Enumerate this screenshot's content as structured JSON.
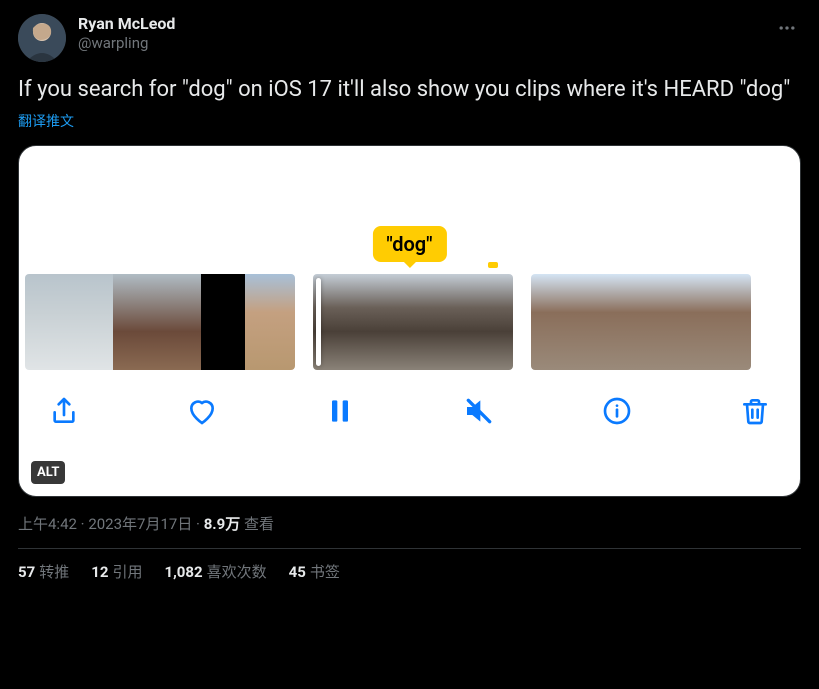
{
  "author": {
    "display_name": "Ryan McLeod",
    "handle": "@warpling"
  },
  "body": "If you search for \"dog\" on iOS 17 it'll also show you clips where it's HEARD \"dog\"",
  "translate_label": "翻译推文",
  "media": {
    "tooltip": "\"dog\"",
    "alt_badge": "ALT"
  },
  "meta": {
    "time": "上午4:42",
    "sep": " · ",
    "date": "2023年7月17日",
    "views_count": "8.9万",
    "views_label": " 查看"
  },
  "stats": {
    "retweets_count": "57",
    "retweets_label": "转推",
    "quotes_count": "12",
    "quotes_label": "引用",
    "likes_count": "1,082",
    "likes_label": "喜欢次数",
    "bookmarks_count": "45",
    "bookmarks_label": "书签"
  }
}
